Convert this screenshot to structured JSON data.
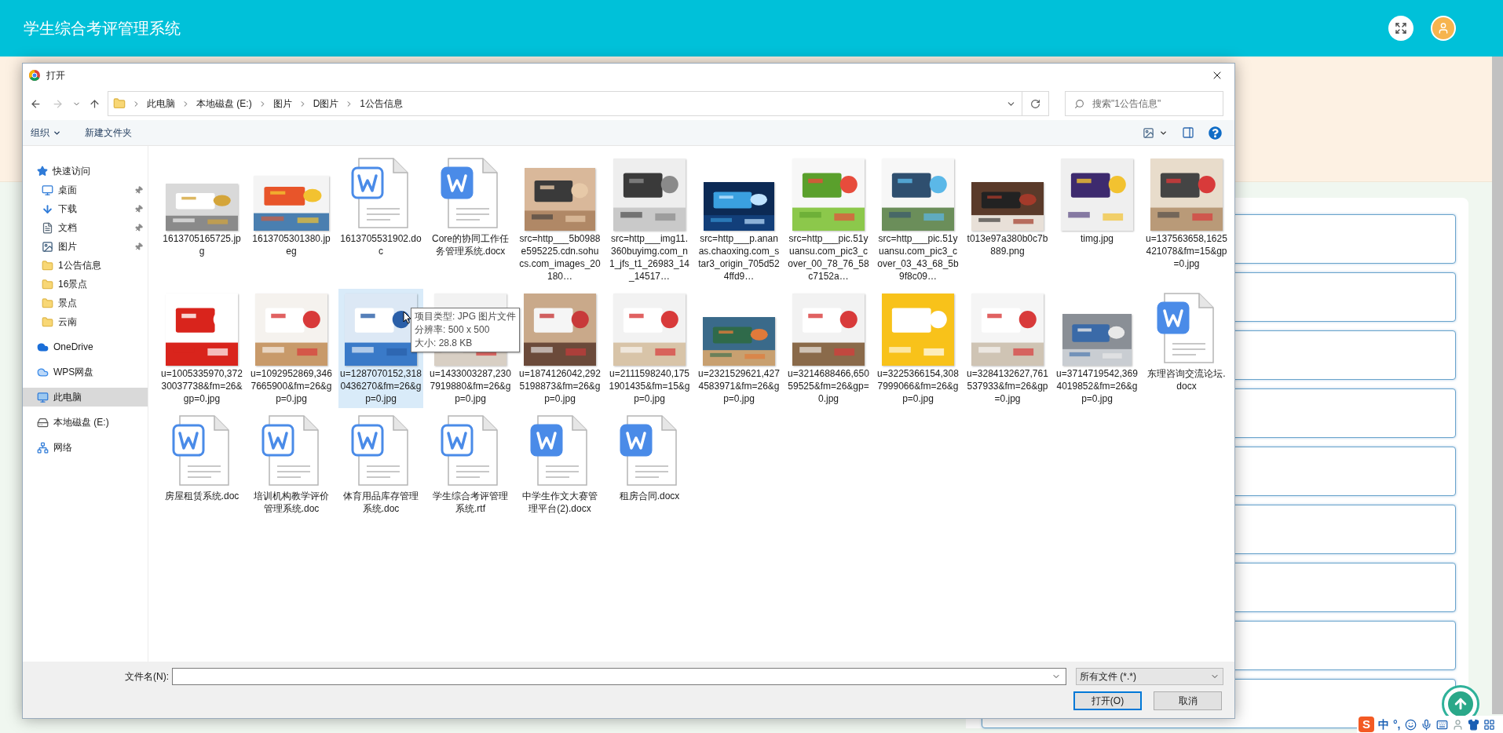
{
  "app": {
    "title": "学生综合考评管理系统"
  },
  "dialog": {
    "title": "打开",
    "breadcrumb": [
      "此电脑",
      "本地磁盘 (E:)",
      "图片",
      "D图片",
      "1公告信息"
    ],
    "search": {
      "placeholder": "搜索\"1公告信息\""
    },
    "toolbar": {
      "organize": "组织",
      "new_folder": "新建文件夹"
    },
    "nav": [
      {
        "label": "快速访问",
        "kind": "star",
        "selected": false,
        "children": [
          {
            "label": "桌面",
            "kind": "desktop",
            "pinned": true,
            "selected": false
          },
          {
            "label": "下载",
            "kind": "download",
            "pinned": true,
            "selected": false
          },
          {
            "label": "文档",
            "kind": "document",
            "pinned": true,
            "selected": false
          },
          {
            "label": "图片",
            "kind": "pictures",
            "pinned": true,
            "selected": false
          },
          {
            "label": "1公告信息",
            "kind": "folder",
            "pinned": false,
            "selected": false
          },
          {
            "label": "16景点",
            "kind": "folder",
            "pinned": false,
            "selected": false
          },
          {
            "label": "景点",
            "kind": "folder",
            "pinned": false,
            "selected": false
          },
          {
            "label": "云南",
            "kind": "folder",
            "pinned": false,
            "selected": false
          }
        ]
      },
      {
        "label": "OneDrive",
        "kind": "cloud",
        "selected": false
      },
      {
        "label": "WPS网盘",
        "kind": "cloud2",
        "selected": false
      },
      {
        "label": "此电脑",
        "kind": "pc",
        "selected": true
      },
      {
        "label": "本地磁盘 (E:)",
        "kind": "drive",
        "selected": false
      },
      {
        "label": "网络",
        "kind": "network",
        "selected": false
      }
    ],
    "files": [
      {
        "name": "1613705165725.jpg",
        "kind": "picture",
        "selected": false
      },
      {
        "name": "1613705301380.jpeg",
        "kind": "picture",
        "selected": false
      },
      {
        "name": "1613705531902.doc",
        "kind": "doc",
        "selected": false
      },
      {
        "name": "Core的协同工作任务管理系统.docx",
        "kind": "docx",
        "selected": false
      },
      {
        "name": "src=http___5b0988e595225.cdn.sohucs.com_images_20180…",
        "kind": "picture",
        "selected": false
      },
      {
        "name": "src=http___img11.360buyimg.com_n1_jfs_t1_26983_14_14517…",
        "kind": "picture",
        "selected": false
      },
      {
        "name": "src=http___p.ananas.chaoxing.com_star3_origin_705d524ffd9…",
        "kind": "picture",
        "selected": false
      },
      {
        "name": "src=http___pic.51yuansu.com_pic3_cover_00_78_76_58c7152a…",
        "kind": "picture",
        "selected": false
      },
      {
        "name": "src=http___pic.51yuansu.com_pic3_cover_03_43_68_5b9f8c09…",
        "kind": "picture",
        "selected": false
      },
      {
        "name": "t013e97a380b0c7b889.png",
        "kind": "picture",
        "selected": false
      },
      {
        "name": "timg.jpg",
        "kind": "picture",
        "selected": false
      },
      {
        "name": "u=137563658,1625421078&fm=15&gp=0.jpg",
        "kind": "picture",
        "selected": false
      },
      {
        "name": "u=1005335970,37230037738&fm=26&gp=0.jpg",
        "kind": "picture",
        "selected": false
      },
      {
        "name": "u=1092952869,3467665900&fm=26&gp=0.jpg",
        "kind": "picture",
        "selected": false
      },
      {
        "name": "u=1287070152,3180436270&fm=26&gp=0.jpg",
        "kind": "picture",
        "selected": true
      },
      {
        "name": "u=1433003287,2307919880&fm=26&gp=0.jpg",
        "kind": "picture",
        "selected": false
      },
      {
        "name": "u=1874126042,2925198873&fm=26&gp=0.jpg",
        "kind": "picture",
        "selected": false
      },
      {
        "name": "u=2111598240,1751901435&fm=15&gp=0.jpg",
        "kind": "picture",
        "selected": false
      },
      {
        "name": "u=2321529621,4274583971&fm=26&gp=0.jpg",
        "kind": "picture",
        "selected": false
      },
      {
        "name": "u=3214688466,65059525&fm=26&gp=0.jpg",
        "kind": "picture",
        "selected": false
      },
      {
        "name": "u=3225366154,3087999066&fm=26&gp=0.jpg",
        "kind": "picture",
        "selected": false
      },
      {
        "name": "u=3284132627,761537933&fm=26&gp=0.jpg",
        "kind": "picture",
        "selected": false
      },
      {
        "name": "u=3714719542,3694019852&fm=26&gp=0.jpg",
        "kind": "picture",
        "selected": false
      },
      {
        "name": "东理咨询交流论坛.docx",
        "kind": "docx",
        "selected": false
      },
      {
        "name": "房屋租赁系统.doc",
        "kind": "doc",
        "selected": false
      },
      {
        "name": "培训机构教学评价管理系统.doc",
        "kind": "doc",
        "selected": false
      },
      {
        "name": "体育用品库存管理系统.doc",
        "kind": "doc",
        "selected": false
      },
      {
        "name": "学生综合考评管理系统.rtf",
        "kind": "doc",
        "selected": false
      },
      {
        "name": "中学生作文大赛管理平台(2).docx",
        "kind": "docx",
        "selected": false
      },
      {
        "name": "租房合同.docx",
        "kind": "docx",
        "selected": false
      }
    ],
    "tooltip": [
      "项目类型: JPG 图片文件",
      "分辨率: 500 x 500",
      "大小: 28.8 KB"
    ],
    "filename_label": "文件名(N):",
    "filetype": "所有文件 (*.*)",
    "buttons": [
      {
        "label": "打开(O)",
        "default": true
      },
      {
        "label": "取消",
        "default": false
      }
    ]
  },
  "ime": {
    "logo": "S",
    "items": [
      "中",
      "°,"
    ]
  }
}
